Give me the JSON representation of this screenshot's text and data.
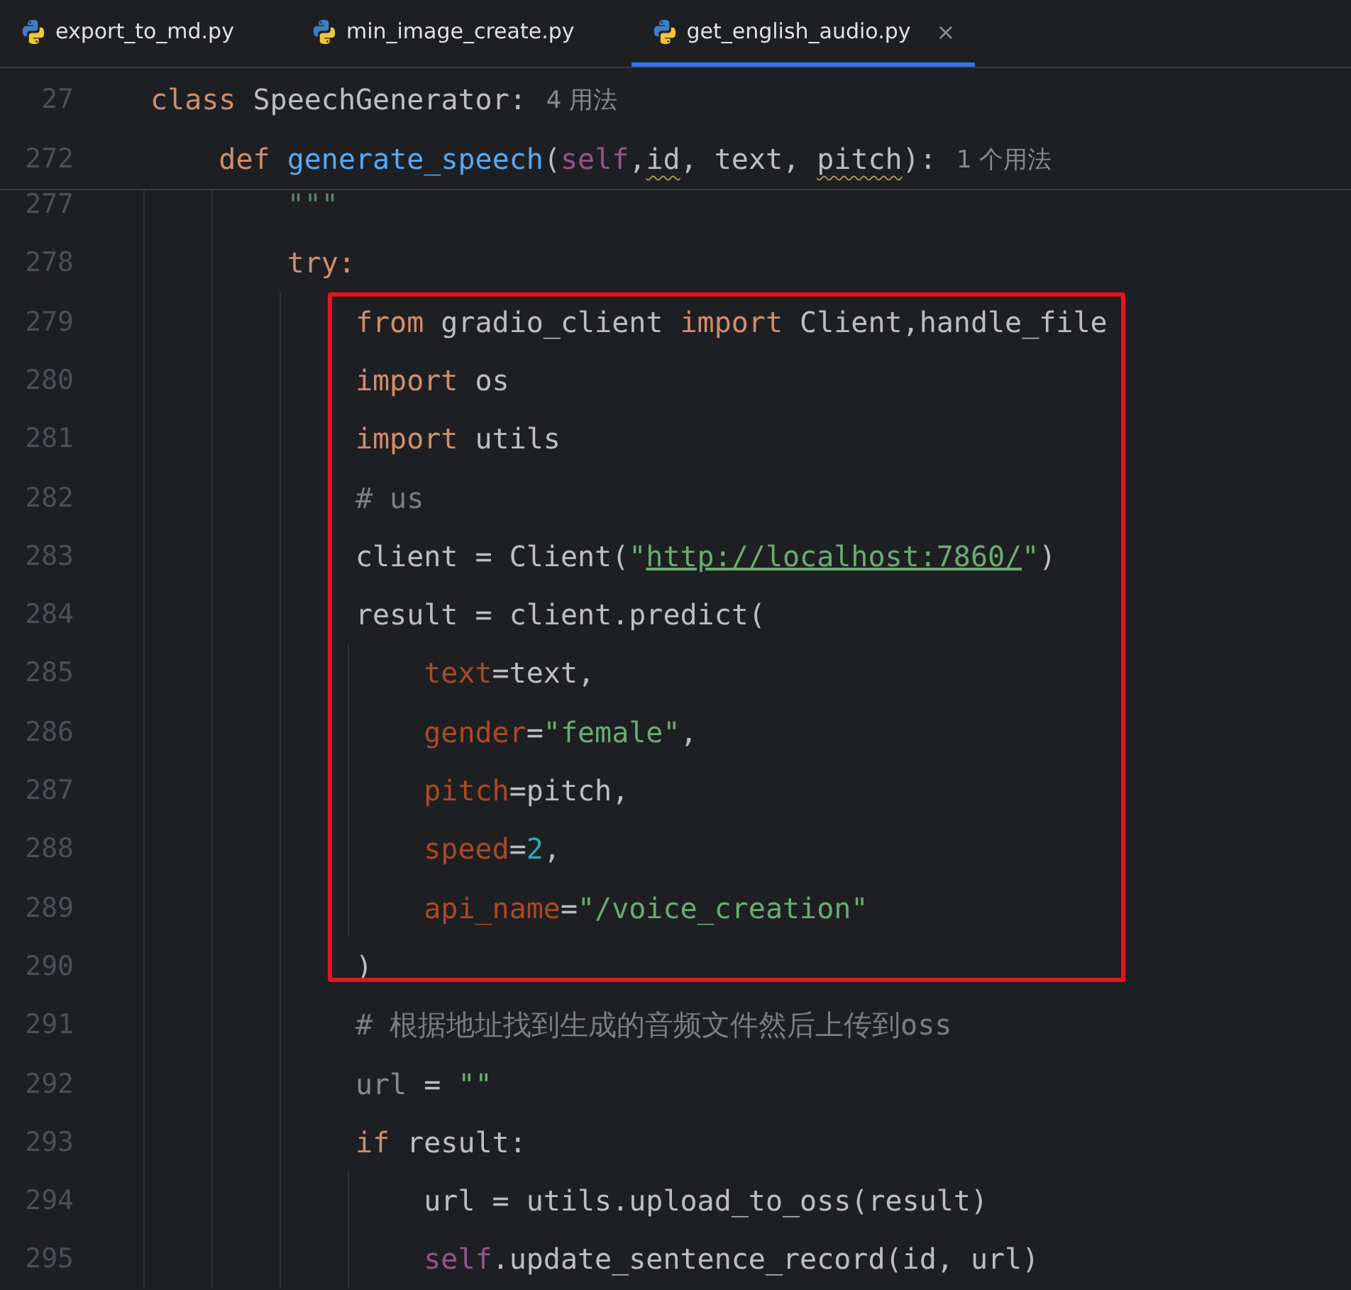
{
  "tabs": [
    {
      "label": "export_to_md.py",
      "selected": false
    },
    {
      "label": "min_image_create.py",
      "selected": false
    },
    {
      "label": "get_english_audio.py",
      "selected": true,
      "close": "×"
    }
  ],
  "sticky_lines": [
    {
      "number": "27",
      "tokens": [
        {
          "text": "class",
          "kind": "keyword"
        },
        {
          "text": " SpeechGenerator:",
          "kind": "plain"
        }
      ],
      "hint": "4 用法"
    },
    {
      "number": "272",
      "tokens": [
        {
          "text": "    def ",
          "kind": "keyword"
        },
        {
          "text": "generate_speech",
          "kind": "function"
        },
        {
          "text": "(",
          "kind": "plain"
        },
        {
          "text": "self",
          "kind": "self"
        },
        {
          "text": ",",
          "kind": "plain"
        },
        {
          "text": "id",
          "kind": "warning"
        },
        {
          "text": ", text, ",
          "kind": "plain"
        },
        {
          "text": "pitch",
          "kind": "warning"
        },
        {
          "text": "):",
          "kind": "plain"
        }
      ],
      "hint": "1 个用法"
    }
  ],
  "blocks": [
    {
      "kind": "plain",
      "lines": [
        {
          "number": "277",
          "tokens": [
            {
              "text": "        \"\"\"",
              "kind": "docstring"
            }
          ]
        },
        {
          "number": "278",
          "tokens": [
            {
              "text": "        try:",
              "kind": "keyword"
            }
          ]
        }
      ]
    },
    {
      "kind": "boxed",
      "lines": [
        {
          "number": "279",
          "tokens": [
            {
              "text": "            from",
              "kind": "keyword"
            },
            {
              "text": " gradio_client ",
              "kind": "plain"
            },
            {
              "text": "import",
              "kind": "keyword"
            },
            {
              "text": " Client,handle_file",
              "kind": "plain"
            }
          ]
        },
        {
          "number": "280",
          "tokens": [
            {
              "text": "            import",
              "kind": "keyword"
            },
            {
              "text": " os",
              "kind": "plain"
            }
          ]
        },
        {
          "number": "281",
          "tokens": [
            {
              "text": "            import",
              "kind": "keyword"
            },
            {
              "text": " utils",
              "kind": "plain"
            }
          ]
        },
        {
          "number": "282",
          "tokens": [
            {
              "text": "            # us",
              "kind": "comment"
            }
          ]
        },
        {
          "number": "283",
          "tokens": [
            {
              "text": "            client = Client(",
              "kind": "plain"
            },
            {
              "text": "\"",
              "kind": "string"
            },
            {
              "text": "http://localhost:7860/",
              "kind": "link"
            },
            {
              "text": "\"",
              "kind": "string"
            },
            {
              "text": ")",
              "kind": "plain"
            }
          ]
        },
        {
          "number": "284",
          "tokens": [
            {
              "text": "            result = client.predict(",
              "kind": "plain"
            }
          ]
        },
        {
          "number": "285",
          "tokens": [
            {
              "text": "                text",
              "kind": "param"
            },
            {
              "text": "=text,",
              "kind": "plain"
            }
          ]
        },
        {
          "number": "286",
          "tokens": [
            {
              "text": "                gender",
              "kind": "param"
            },
            {
              "text": "=",
              "kind": "plain"
            },
            {
              "text": "\"female\"",
              "kind": "string"
            },
            {
              "text": ",",
              "kind": "plain"
            }
          ]
        },
        {
          "number": "287",
          "tokens": [
            {
              "text": "                pitch",
              "kind": "param"
            },
            {
              "text": "=pitch,",
              "kind": "plain"
            }
          ]
        },
        {
          "number": "288",
          "tokens": [
            {
              "text": "                speed",
              "kind": "param"
            },
            {
              "text": "=",
              "kind": "plain"
            },
            {
              "text": "2",
              "kind": "number"
            },
            {
              "text": ",",
              "kind": "plain"
            }
          ]
        },
        {
          "number": "289",
          "tokens": [
            {
              "text": "                api_name",
              "kind": "param"
            },
            {
              "text": "=",
              "kind": "plain"
            },
            {
              "text": "\"/voice_creation\"",
              "kind": "string"
            }
          ]
        },
        {
          "number": "290",
          "tokens": [
            {
              "text": "            )",
              "kind": "plain"
            }
          ]
        }
      ]
    },
    {
      "kind": "plain",
      "lines": [
        {
          "number": "291",
          "tokens": [
            {
              "text": "            # 根据地址找到生成的音频文件然后上传到oss",
              "kind": "comment"
            }
          ]
        },
        {
          "number": "292",
          "tokens": [
            {
              "text": "            url",
              "kind": "unused"
            },
            {
              "text": " = ",
              "kind": "plain"
            },
            {
              "text": "\"\"",
              "kind": "string"
            }
          ]
        },
        {
          "number": "293",
          "tokens": [
            {
              "text": "            if",
              "kind": "keyword"
            },
            {
              "text": " result:",
              "kind": "plain"
            }
          ]
        },
        {
          "number": "294",
          "tokens": [
            {
              "text": "                url = utils.upload_to_oss(result)",
              "kind": "plain"
            }
          ]
        },
        {
          "number": "295",
          "tokens": [
            {
              "text": "                self",
              "kind": "self"
            },
            {
              "text": ".update_sentence_record(id, url)",
              "kind": "plain"
            }
          ]
        }
      ]
    }
  ]
}
